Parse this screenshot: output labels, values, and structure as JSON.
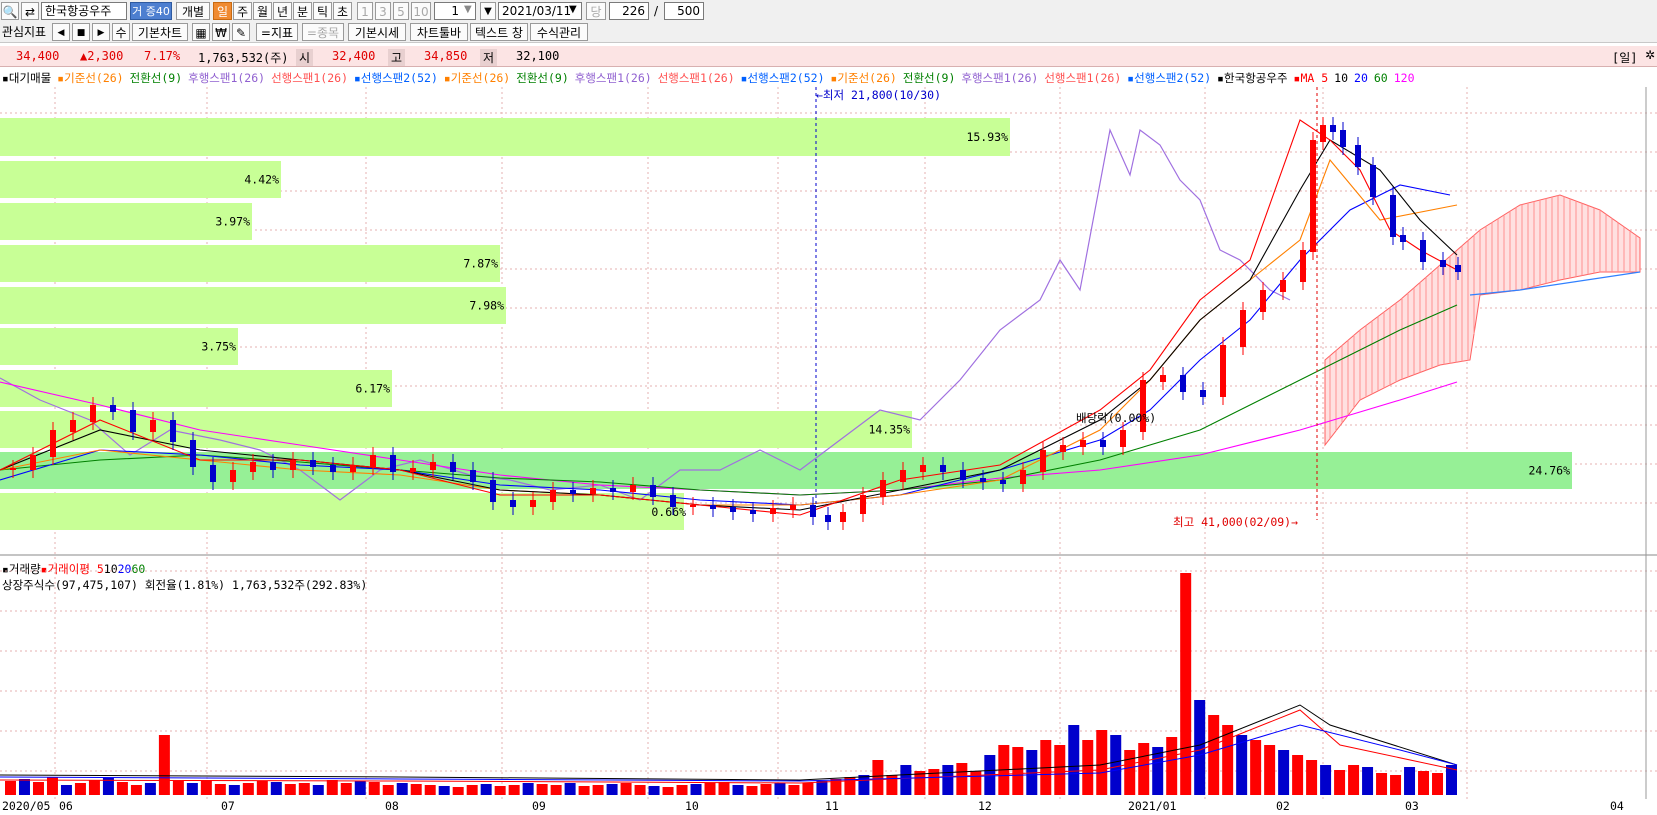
{
  "toolbar1": {
    "search_icon": "🔍",
    "refresh_icon": "⇄",
    "stock_name": "한국항공우주",
    "badge": "거 증40",
    "individual": "개별",
    "period_day": "일",
    "period_week": "주",
    "period_month": "월",
    "period_year": "년",
    "period_minute": "분",
    "period_tick": "틱",
    "period_second": "초",
    "n1": "1",
    "n3": "3",
    "n5": "5",
    "n10": "10",
    "interval_value": "1",
    "date_value": "2021/03/11",
    "dang": "당",
    "count_value": "226",
    "slash": "/",
    "total_value": "500"
  },
  "toolbar2": {
    "watch_indicator": "관심지표",
    "prev": "◀",
    "stop": "■",
    "next": "▶",
    "su": "수",
    "basic_chart": "기본차트",
    "icon1": "▦",
    "icon2": "₩",
    "icon3": "✎",
    "indicator": "=지표",
    "stock": "=종목",
    "basic_quote": "기본시세",
    "chart_toolbar": "차트툴바",
    "text_window": "텍스트 창",
    "formula_mgmt": "수식관리"
  },
  "pricebar": {
    "price": "34,400",
    "change": "▲2,300",
    "rate": "7.17%",
    "volume": "1,763,532(주)",
    "open_label": "시",
    "open": "32,400",
    "high_label": "고",
    "high": "34,850",
    "low_label": "저",
    "low": "32,100",
    "period_tag": "[일]"
  },
  "legend": {
    "items": [
      {
        "text": "▪대기매물",
        "color": "#000000"
      },
      {
        "text": "▪기준선(26)",
        "color": "#ff8000"
      },
      {
        "text": "전환선(9)",
        "color": "#008000"
      },
      {
        "text": "후행스팬1(26)",
        "color": "#9060d0"
      },
      {
        "text": "선행스팬1(26)",
        "color": "#ff5050"
      },
      {
        "text": "▪선행스팬2(52)",
        "color": "#0060ff"
      },
      {
        "text": "▪기준선(26)",
        "color": "#ff8000"
      },
      {
        "text": "전환선(9)",
        "color": "#008000"
      },
      {
        "text": "후행스팬1(26)",
        "color": "#9060d0"
      },
      {
        "text": "선행스팬1(26)",
        "color": "#ff5050"
      },
      {
        "text": "▪선행스팬2(52)",
        "color": "#0060ff"
      },
      {
        "text": "▪기준선(26)",
        "color": "#ff8000"
      },
      {
        "text": "전환선(9)",
        "color": "#008000"
      },
      {
        "text": "후행스팬1(26)",
        "color": "#9060d0"
      },
      {
        "text": "선행스팬1(26)",
        "color": "#ff5050"
      },
      {
        "text": "▪선행스팬2(52)",
        "color": "#0060ff"
      },
      {
        "text": "▪한국항공우주",
        "color": "#000000"
      },
      {
        "text": "▪MA 5",
        "color": "#ff0000"
      },
      {
        "text": "10",
        "color": "#000000"
      },
      {
        "text": "20",
        "color": "#0000ff"
      },
      {
        "text": "60",
        "color": "#008000"
      },
      {
        "text": "120",
        "color": "#ff00ff"
      }
    ]
  },
  "volume_legend": {
    "items": [
      {
        "text": "▪거래량",
        "color": "#000000"
      },
      {
        "text": "▪거래이평 5",
        "color": "#ff0000"
      },
      {
        "text": "10",
        "color": "#000000"
      },
      {
        "text": "20",
        "color": "#0000ff"
      },
      {
        "text": "60",
        "color": "#008000"
      }
    ],
    "info": "상장주식수(97,475,107) 회전율(1.81%) 1,763,532주(292.83%)"
  },
  "annotations": {
    "low": "←최저 21,800(10/30)",
    "high": "최고 41,000(02/09)→",
    "dividend": "배당락(0.00%)"
  },
  "chart_data": {
    "type": "candlestick",
    "x_ticks": [
      "2020/05",
      "06",
      "07",
      "08",
      "09",
      "10",
      "11",
      "12",
      "2021/01",
      "02",
      "03",
      "04"
    ],
    "price_low": {
      "value": 21800,
      "date": "10/30"
    },
    "price_high": {
      "value": 41000,
      "date": "02/09"
    },
    "last_bar": {
      "open": 32400,
      "high": 34850,
      "low": 32100,
      "close": 34400,
      "volume": 1763532
    },
    "volume_profile": [
      {
        "percent": "15.93%"
      },
      {
        "percent": "4.42%"
      },
      {
        "percent": "3.97%"
      },
      {
        "percent": "7.87%"
      },
      {
        "percent": "7.98%"
      },
      {
        "percent": "3.75%"
      },
      {
        "percent": "6.17%"
      },
      {
        "percent": "14.35%"
      },
      {
        "percent": "24.76%"
      },
      {
        "percent": "0.66%"
      }
    ],
    "colors": {
      "up": "#ff0000",
      "down": "#0000cc",
      "profile": "#c8ff96",
      "profile_max": "#96f096"
    }
  }
}
